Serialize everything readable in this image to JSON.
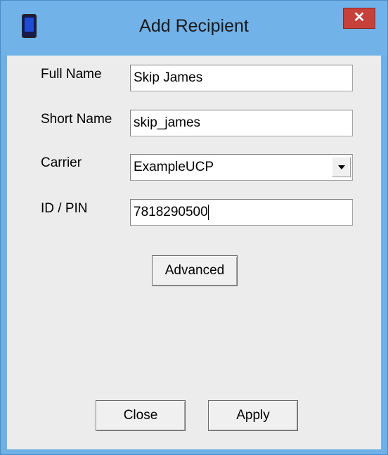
{
  "window": {
    "title": "Add Recipient",
    "close_glyph": "✕",
    "app_icon": "mobile-phone-icon"
  },
  "form": {
    "full_name": {
      "label": "Full Name",
      "value": "Skip James"
    },
    "short_name": {
      "label": "Short Name",
      "value": "skip_james"
    },
    "carrier": {
      "label": "Carrier",
      "value": "ExampleUCP"
    },
    "id_pin": {
      "label": "ID / PIN",
      "value": "7818290500"
    }
  },
  "buttons": {
    "advanced": "Advanced",
    "close": "Close",
    "apply": "Apply"
  },
  "colors": {
    "titlebar": "#71b3e8",
    "close_button": "#c7403a",
    "dialog_background": "#ececec"
  }
}
